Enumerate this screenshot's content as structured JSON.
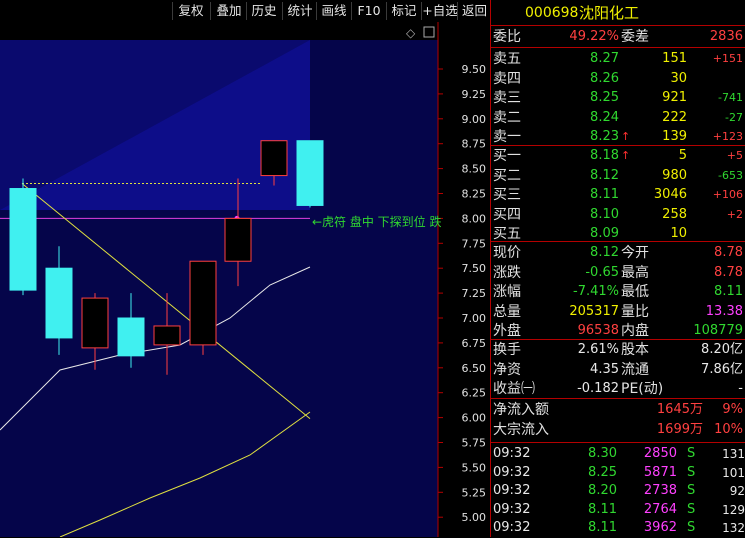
{
  "toolbar": {
    "buttons": [
      "复权",
      "叠加",
      "历史",
      "统计",
      "画线",
      "F10",
      "标记",
      "+自选",
      "返回"
    ]
  },
  "header": {
    "code": "000698",
    "name": "沈阳化工"
  },
  "committee": {
    "ratio_label": "委比",
    "ratio_value": "49.22%",
    "diff_label": "委差",
    "diff_value": "2836"
  },
  "asks": [
    {
      "label": "卖五",
      "price": "8.27",
      "vol": "151",
      "chg": "+151"
    },
    {
      "label": "卖四",
      "price": "8.26",
      "vol": "30",
      "chg": ""
    },
    {
      "label": "卖三",
      "price": "8.25",
      "vol": "921",
      "chg": "-741"
    },
    {
      "label": "卖二",
      "price": "8.24",
      "vol": "222",
      "chg": "-27"
    },
    {
      "label": "卖一",
      "price": "8.23",
      "vol": "139",
      "chg": "+123",
      "arrow": "↑"
    }
  ],
  "bids": [
    {
      "label": "买一",
      "price": "8.18",
      "vol": "5",
      "chg": "+5",
      "arrow": "↑"
    },
    {
      "label": "买二",
      "price": "8.12",
      "vol": "980",
      "chg": "-653"
    },
    {
      "label": "买三",
      "price": "8.11",
      "vol": "3046",
      "chg": "+106"
    },
    {
      "label": "买四",
      "price": "8.10",
      "vol": "258",
      "chg": "+2"
    },
    {
      "label": "买五",
      "price": "8.09",
      "vol": "10",
      "chg": ""
    }
  ],
  "quote": {
    "now_label": "现价",
    "now": "8.12",
    "open_label": "今开",
    "open": "8.78",
    "chg_label": "涨跌",
    "chg": "-0.65",
    "high_label": "最高",
    "high": "8.78",
    "pct_label": "涨幅",
    "pct": "-7.41%",
    "low_label": "最低",
    "low": "8.11",
    "vol_label": "总量",
    "vol": "205317",
    "vr_label": "量比",
    "vr": "13.38",
    "outer_label": "外盘",
    "outer": "96538",
    "inner_label": "内盘",
    "inner": "108779"
  },
  "fundamentals": {
    "turnover_label": "换手",
    "turnover": "2.61%",
    "equity_label": "股本",
    "equity": "8.20亿",
    "nav_label": "净资",
    "nav": "4.35",
    "float_label": "流通",
    "float": "7.86亿",
    "eps_label": "收益㈠",
    "eps": "-0.182",
    "pe_label": "PE(动)",
    "pe": "-"
  },
  "flows": [
    {
      "label": "净流入额",
      "amount": "1645万",
      "pct": "9%"
    },
    {
      "label": "大宗流入",
      "amount": "1699万",
      "pct": "10%"
    }
  ],
  "ticks": [
    {
      "time": "09:32",
      "price": "8.30",
      "vol": "2850",
      "side": "S",
      "n": "131"
    },
    {
      "time": "09:32",
      "price": "8.25",
      "vol": "5871",
      "side": "S",
      "n": "101"
    },
    {
      "time": "09:32",
      "price": "8.20",
      "vol": "2738",
      "side": "S",
      "n": "92"
    },
    {
      "time": "09:32",
      "price": "8.11",
      "vol": "2764",
      "side": "S",
      "n": "129"
    },
    {
      "time": "09:32",
      "price": "8.11",
      "vol": "3962",
      "side": "S",
      "n": "132"
    }
  ],
  "chart_data": {
    "type": "candlestick",
    "y_ticks": [
      "9.50",
      "9.25",
      "9.00",
      "8.75",
      "8.50",
      "8.25",
      "8.00",
      "7.75",
      "7.50",
      "7.25",
      "7.00",
      "6.75",
      "6.50",
      "6.25",
      "6.00",
      "5.75",
      "5.50",
      "5.25",
      "5.00"
    ],
    "ylim": [
      4.92,
      9.85
    ],
    "candles": [
      {
        "open": 7.28,
        "close": 8.3,
        "high": 8.4,
        "low": 7.23,
        "dir": "down"
      },
      {
        "open": 6.8,
        "close": 7.5,
        "high": 7.72,
        "low": 6.63,
        "dir": "down"
      },
      {
        "open": 6.7,
        "close": 7.2,
        "high": 7.25,
        "low": 6.48,
        "dir": "up"
      },
      {
        "open": 6.62,
        "close": 7.0,
        "high": 7.25,
        "low": 6.5,
        "dir": "down"
      },
      {
        "open": 6.73,
        "close": 6.92,
        "high": 7.25,
        "low": 6.43,
        "dir": "up"
      },
      {
        "open": 6.73,
        "close": 7.57,
        "high": 7.57,
        "low": 6.63,
        "dir": "up"
      },
      {
        "open": 7.57,
        "close": 8.0,
        "high": 8.4,
        "low": 7.32,
        "dir": "up"
      },
      {
        "open": 8.43,
        "close": 8.78,
        "high": 8.78,
        "low": 8.33,
        "dir": "up"
      },
      {
        "open": 8.78,
        "close": 8.13,
        "high": 8.78,
        "low": 8.11,
        "dir": "down"
      }
    ],
    "annotation": "←虎符 盘中 下探到位 跌"
  }
}
